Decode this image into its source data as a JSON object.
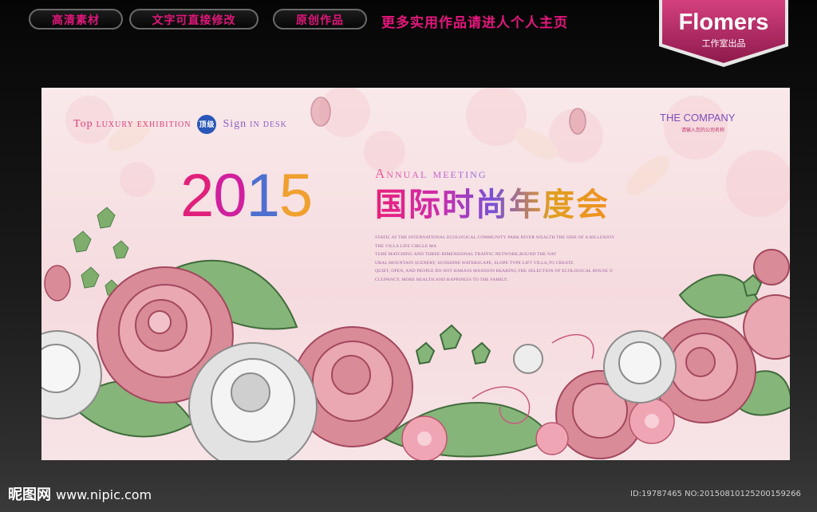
{
  "top_bar": {
    "buttons": [
      "高清素材",
      "文字可直接修改",
      "原创作品"
    ],
    "promo_text": "更多实用作品请进人个人主页"
  },
  "brand": {
    "name": "Flomers",
    "subtitle": "工作室出品",
    "color": "#c0336e"
  },
  "poster": {
    "tagline_left": [
      "Top",
      "luxury",
      "exhibition"
    ],
    "badge": "顶级",
    "tagline_right": [
      "Sign",
      "in",
      "desk"
    ],
    "company": "THE COMPANY",
    "company_sub": "请输入您的公司名称",
    "year_digits": [
      "2",
      "0",
      "1",
      "5"
    ],
    "year_colors": [
      "#e0207a",
      "#d0209e",
      "#4d6fd0",
      "#f0a030"
    ],
    "annual": "Annual meeting",
    "title": "国际时尚年度会",
    "paragraph": [
      "STATIC AT THE INTERNATIONAL ECOLOGICAL COMMUNITY PARK RIVER WEALTH THE SIDE OF A HILLENJOY",
      "THE VILLA LIFE CIRCLE MA",
      "TURE MATCHING AND THREE-DIMENSIONAL TRAFFIC NETWORK,ROUND THE NAT",
      "URAL MOUNTAIN SCENERY, SUNSHINE WATERSCAPE, SLOPE TYPE LIFT VILLA,TO CREATE",
      "QUIET, OPEN, AND PEOPLE DO NOT HARASS MANSION BEARING,THE SELECTION OF ECOLOGICAL HOUSE O",
      "CCUPANCY, MORE HEALTH AND HAPPINESS TO THE FAMILY."
    ]
  },
  "watermark": {
    "site_name": "昵图网",
    "url": "www.nipic.com",
    "image_id": "ID:19787465 NO:20150810125200159266"
  }
}
